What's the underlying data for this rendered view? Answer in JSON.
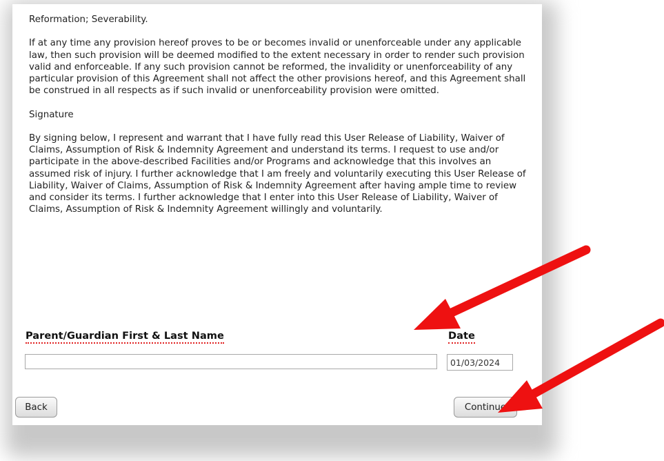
{
  "agreement": {
    "heading_reformation": "Reformation; Severability.",
    "para_reformation": "If at any time any provision hereof proves to be or becomes invalid or unenforceable under any applicable law, then such provision will be deemed modified to the extent necessary in order to render such provision valid and enforceable. If any such provision cannot be reformed, the invalidity or unenforceability of any particular provision of this Agreement shall not affect the other provisions hereof, and this Agreement shall be construed in all respects as if such invalid or unenforceability provision were omitted.",
    "heading_signature": "Signature",
    "para_signature": "By signing below, I represent and warrant that I have fully read this User Release of Liability, Waiver of Claims, Assumption of Risk & Indemnity Agreement and understand its terms. I request to use and/or participate in the above-described Facilities and/or Programs and acknowledge that this involves an assumed risk of injury. I further acknowledge that I am freely and voluntarily executing this User Release of Liability, Waiver of Claims, Assumption of Risk & Indemnity Agreement after having ample time to review and consider its terms. I further acknowledge that I enter into this User Release of Liability, Waiver of Claims, Assumption of Risk & Indemnity Agreement willingly and voluntarily."
  },
  "form": {
    "name_label": "Parent/Guardian First & Last Name",
    "name_value": "",
    "date_label": "Date",
    "date_value": "01/03/2024"
  },
  "buttons": {
    "back": "Back",
    "continue": "Continue"
  },
  "annotations": {
    "arrow_color": "#ee1111",
    "arrow_icon": "red-arrow-icon"
  }
}
